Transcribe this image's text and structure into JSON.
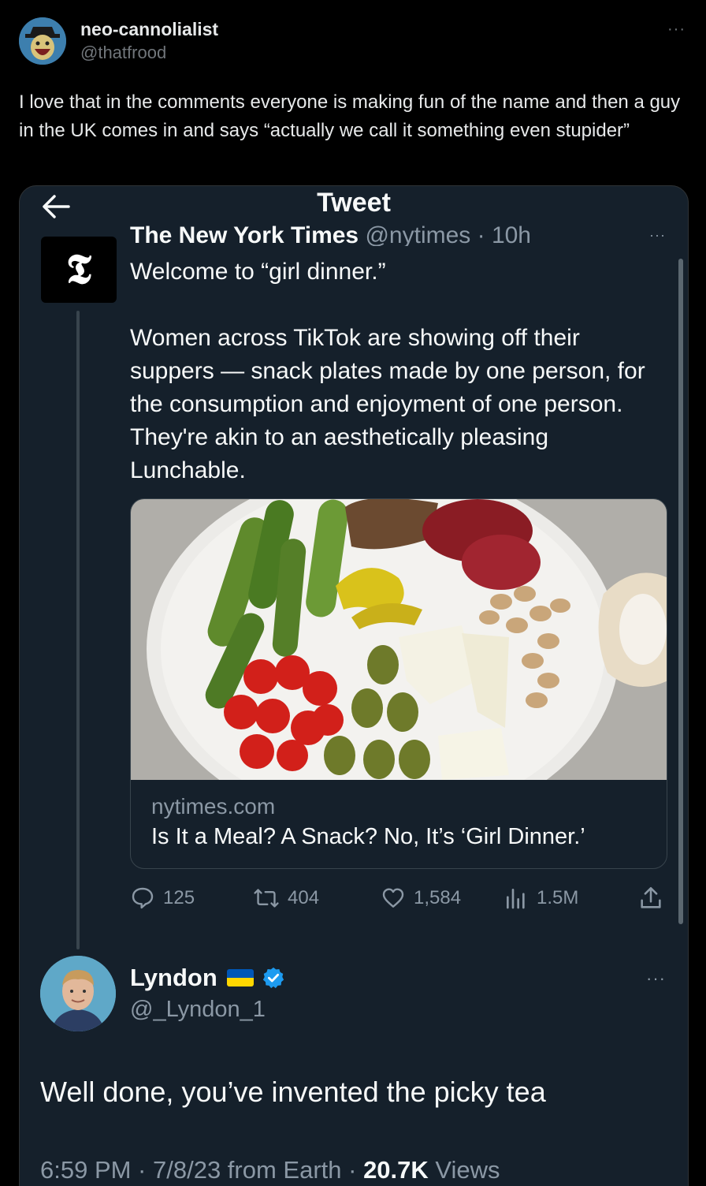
{
  "post": {
    "display_name": "neo-cannolialist",
    "handle": "@thatfrood",
    "more": "···",
    "text": "I love that in the comments everyone is making fun of the name and then a guy in the UK comes in and says “actually we call it something even stupider”"
  },
  "screenshot": {
    "title": "Tweet",
    "nyt": {
      "logo_glyph": "𝕿",
      "display_name": "The New York Times",
      "handle_time": "@nytimes · 10h",
      "more": "···",
      "text": "Welcome to “girl dinner.”\n\nWomen across TikTok are showing off their suppers — snack plates made by one person, for the consumption and enjoyment of one person. They're akin to an aesthetically pleasing Lunchable.",
      "link_domain": "nytimes.com",
      "link_title": "Is It a Meal? A Snack? No, It’s ‘Girl Dinner.’",
      "stats": {
        "replies": "125",
        "retweets": "404",
        "likes": "1,584",
        "views": "1.5M"
      }
    },
    "reply": {
      "display_name": "Lyndon",
      "handle": "@_Lyndon_1",
      "more": "···",
      "text": "Well done, you’ve invented the picky tea",
      "time_date": "6:59 PM · 7/8/23 from Earth · ",
      "views_count": "20.7K",
      "views_label": " Views"
    }
  },
  "colors": {
    "background": "#000000",
    "card_background": "#15202b",
    "muted_text": "#8b98a5",
    "verified_blue": "#1d9bf0",
    "flag_blue": "#0057b7",
    "flag_yellow": "#ffd700"
  }
}
